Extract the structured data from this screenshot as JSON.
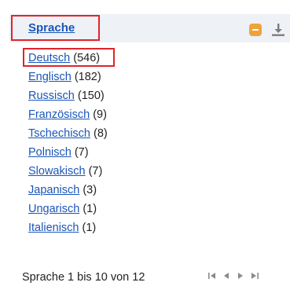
{
  "facet": {
    "title": "Sprache",
    "collapse_icon": "collapse-icon",
    "download_icon": "download-icon",
    "items": [
      {
        "label": "Deutsch",
        "count": "(546)"
      },
      {
        "label": "Englisch",
        "count": "(182)"
      },
      {
        "label": "Russisch",
        "count": "(150)"
      },
      {
        "label": "Französisch",
        "count": "(9)"
      },
      {
        "label": "Tschechisch",
        "count": "(8)"
      },
      {
        "label": "Polnisch",
        "count": "(7)"
      },
      {
        "label": "Slowakisch",
        "count": "(7)"
      },
      {
        "label": "Japanisch",
        "count": "(3)"
      },
      {
        "label": "Ungarisch",
        "count": "(1)"
      },
      {
        "label": "Italienisch",
        "count": "(1)"
      }
    ],
    "footer": "Sprache 1 bis 10 von 12"
  },
  "colors": {
    "link": "#1a56b8",
    "highlight_border": "#e0242b",
    "header_band": "#eef1f6",
    "collapse_icon": "#f0a23a"
  }
}
